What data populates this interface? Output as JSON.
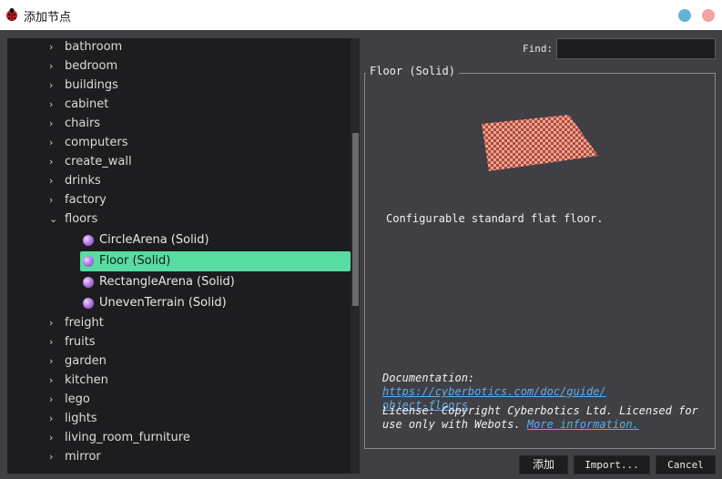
{
  "window": {
    "title": "添加节点",
    "icon": "ladybug-icon",
    "controls": [
      "minimize",
      "close"
    ],
    "control_colors": {
      "minimize": "#62b4d6",
      "close": "#f4a3a3"
    }
  },
  "tree": {
    "folders_before": [
      "bathroom",
      "bedroom",
      "buildings",
      "cabinet",
      "chairs",
      "computers",
      "create_wall",
      "drinks",
      "factory"
    ],
    "expanded_folder": "floors",
    "children": [
      {
        "label": "CircleArena (Solid)",
        "selected": false
      },
      {
        "label": "Floor (Solid)",
        "selected": true
      },
      {
        "label": "RectangleArena (Solid)",
        "selected": false
      },
      {
        "label": "UnevenTerrain (Solid)",
        "selected": false
      }
    ],
    "folders_after": [
      "freight",
      "fruits",
      "garden",
      "kitchen",
      "lego",
      "lights",
      "living_room_furniture",
      "mirror"
    ],
    "selection_color": "#58dca1"
  },
  "find": {
    "label": "Find:",
    "value": ""
  },
  "details": {
    "group_title": "Floor (Solid)",
    "description": "Configurable standard flat floor.",
    "doc_prefix": "Documentation: ",
    "doc_link_1": "https://cyberbotics.com/doc/guide/",
    "doc_link_2": "object-floors",
    "license_line_1": "License: Copyright Cyberbotics Ltd. Licensed for",
    "license_line_2": "use only with Webots. ",
    "license_link": "More information."
  },
  "buttons": {
    "add": "添加",
    "import": "Import...",
    "cancel": "Cancel"
  },
  "colors": {
    "background": "#3f3f44",
    "panel": "#1d1d20",
    "link": "#5eaee8"
  }
}
